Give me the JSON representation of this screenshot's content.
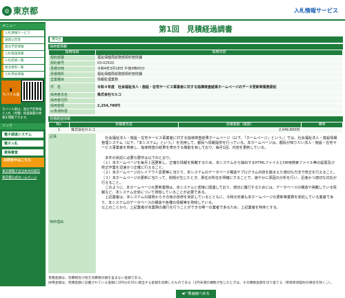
{
  "header": {
    "logo_text": "東京都",
    "system_link": "入札情報サービス"
  },
  "sidebar": {
    "menu_head": "メニュー",
    "items": [
      "入札情報サービス",
      "調達公告等",
      "発注予定情報",
      "入札経過調書",
      "入札結果一覧",
      "発注者別一覧",
      "入札参加情報"
    ],
    "mobile_label": "モバイル版",
    "mobile_note": "モバイル版は、発注予定情報と入札（見積）経過調書の情報を閲覧できます。",
    "links_head": "リンク",
    "link1": "電子調達システム",
    "link2": "電子入札",
    "link3": "資格審査",
    "orange_label": "お問合せはこちら",
    "bottom_links": [
      "東京都電子自治体共同運営",
      "東京都公式ホームページ"
    ]
  },
  "main": {
    "title": "第1回　見積経過調書",
    "tab": "第1回",
    "section1": "採用者情報",
    "col_item": "採用項目",
    "col_content": "採用内容",
    "rows": [
      {
        "label": "契約部署",
        "value": "福祉保健局総務部契約管財課"
      },
      {
        "label": "契約番号",
        "value": "03-02503"
      },
      {
        "label": "見積日時",
        "value": "令和4年3月18日 午後0時00分"
      },
      {
        "label": "見積場所",
        "value": "福祉保健局総務部契約管財課"
      },
      {
        "label": "営業種目",
        "value": "情報処理業務"
      }
    ],
    "kenmei_label": "件　名",
    "kenmei_value": "令和４年度　社会福祉法人・施設・在宅サービス事業者に対する指導検査結果ホームページのデータ更新等業務委託",
    "rows2": [
      {
        "label": "採用者氏名",
        "value": "株式会社セルコ"
      },
      {
        "label": "採用者住所",
        "value": ""
      },
      {
        "label": "採用金額",
        "value": "2,254,780円"
      },
      {
        "label": "公表通知書",
        "value": ""
      }
    ],
    "section2": "見積経過情報",
    "bid_headers": [
      "No.",
      "見積者氏名",
      "見積金額（税抜）",
      "備考"
    ],
    "bid_row": [
      "1",
      "株式会社セルコ",
      "2,049,800円",
      ""
    ],
    "remark_label": "記事",
    "reason_label": "特命理由",
    "remark_text": "　社会福祉法人・施設・在宅サービス事業者に対する指導検査結果ホームページ（以下、「ホームページ」という。）では、社会福祉法人・施設情報管理システム（以下、「本システム」という。）を活用して、都民へ情報提供を行っている。本ホームページは、都民が知りたい法人・施設・在宅サービス事業者を検索し、指導検査の結果を表示する機能を有しており、毎月1回、内容を更新している。\n\n　本件の受託に必要な要件は以下のとおり。\n（１）本ホームページを毎月１回更新し、正確な情報を掲載するため、本システムから抽出するHTMLファイルとDB用検索ファイル等の設置及び修正作業を迅速かつ正確に行えること。\n（２）本ホームページのレイアウト変更等に当たり、本システムのデータベース構造やプログラム内容を踏まえた適切な方法で修正を行えること。\n（３）本ホームページの更新に当たって、問題が生じたとき、責任の所在を明確にすることで、速やかに原因の分析を行い、迅速かつ適切な対応が行えること。\n　このように、本ホームページの更新業務は、本システムと密接に関連しており、適切に履行するためには、データベースの構造や掲載している情報など、本システム全体について熟知していることが必要である。\n　上記業者は、本システムの開発からその後の改修を受託しているとともに、令和元年度も本ホームページの更新等業務を受託している業者であり、本システムのデータベースの構造や各種の情報等を熟知している。\n以上のことから、上記業者が本業務の履行を行うことができる唯一の業者であるため、上記業者を特命とする。",
    "footnote": "見積金額は、消費税及び地方消費税の額を含まない金額である。\n採用金額は、見積金額に記載されている金額に100分の10に相当する金額を加算したものである（1円未満の端数が生じたときは、その端数金額を切り捨てる（単価単価契約の場合を除く。））。",
    "back_button": "◀一覧画面へ戻る"
  }
}
